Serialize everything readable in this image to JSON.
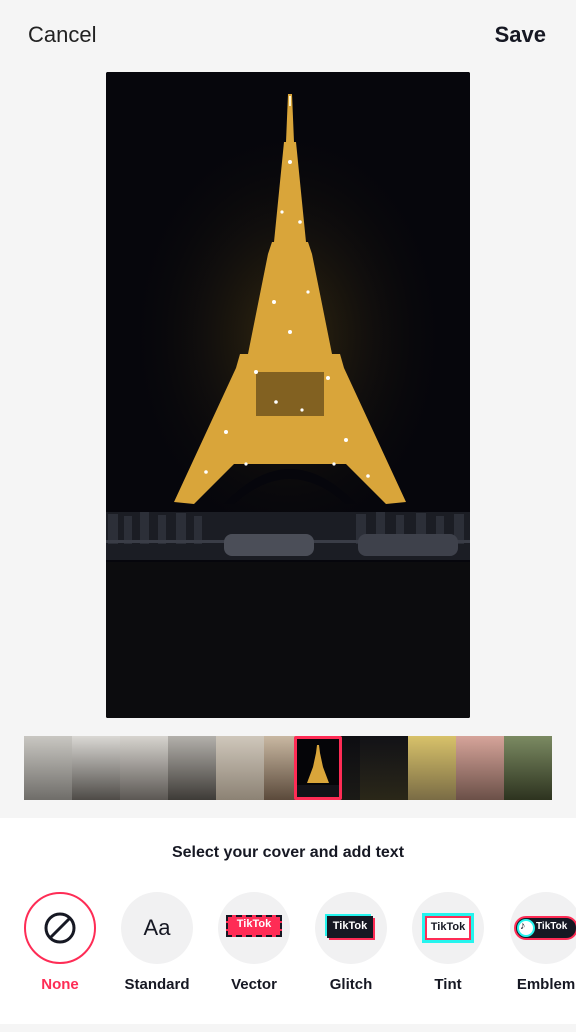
{
  "header": {
    "cancel_label": "Cancel",
    "save_label": "Save"
  },
  "cover_picker": {
    "title": "Select your cover and add text",
    "options": [
      {
        "label": "None",
        "icon": "no-entry-icon",
        "selected": true
      },
      {
        "label": "Standard",
        "icon_text": "Aa"
      },
      {
        "label": "Vector",
        "badge_text": "TikTok"
      },
      {
        "label": "Glitch",
        "badge_text": "TikTok"
      },
      {
        "label": "Tint",
        "badge_text": "TikTok"
      },
      {
        "label": "Emblem",
        "badge_text": "TikTok"
      }
    ]
  },
  "colors": {
    "accent": "#fe2c55",
    "text": "#161823",
    "background": "#f5f5f5",
    "sheet": "#ffffff",
    "glitch_cyan": "#25f4ee"
  }
}
